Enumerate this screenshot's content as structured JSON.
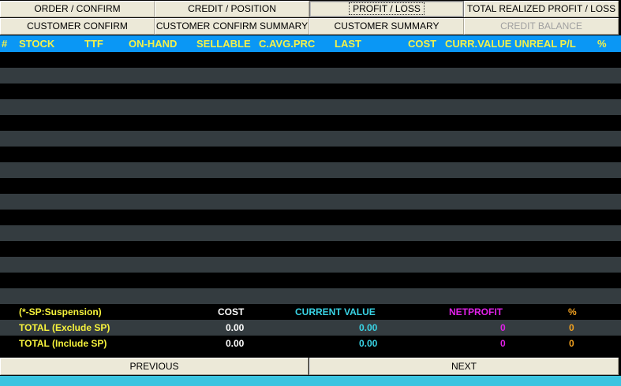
{
  "tabs_row1": [
    "ORDER / CONFIRM",
    "CREDIT / POSITION",
    "PROFIT / LOSS",
    "TOTAL REALIZED PROFIT / LOSS"
  ],
  "tabs_row2": [
    "CUSTOMER CONFIRM",
    "CUSTOMER CONFIRM SUMMARY",
    "CUSTOMER SUMMARY",
    "CREDIT BALANCE"
  ],
  "active_tab": "PROFIT / LOSS",
  "disabled_tab": "CREDIT BALANCE",
  "columns": [
    "#",
    "STOCK",
    "TTF",
    "ON-HAND",
    "SELLABLE",
    "C.AVG.PRC",
    "LAST",
    "COST",
    "CURR.VALUE",
    "UNREAL P/L",
    "%"
  ],
  "summary": {
    "note": "(*-SP:Suspension)",
    "headers": {
      "cost": "COST",
      "current_value": "CURRENT VALUE",
      "netprofit": "NETPROFIT",
      "percent": "%"
    },
    "exclude": {
      "label": "TOTAL (Exclude SP)",
      "cost": "0.00",
      "current_value": "0.00",
      "netprofit": "0",
      "percent": "0"
    },
    "include": {
      "label": "TOTAL (Include SP)",
      "cost": "0.00",
      "current_value": "0.00",
      "netprofit": "0",
      "percent": "0"
    }
  },
  "nav": {
    "previous": "PREVIOUS",
    "next": "NEXT"
  },
  "colors": {
    "header_bg": "#0a97f5",
    "header_text": "#f4f14a",
    "row_alt": "#343c40",
    "cyan": "#39d4e6",
    "magenta": "#e021e8",
    "orange": "#f0a020"
  }
}
